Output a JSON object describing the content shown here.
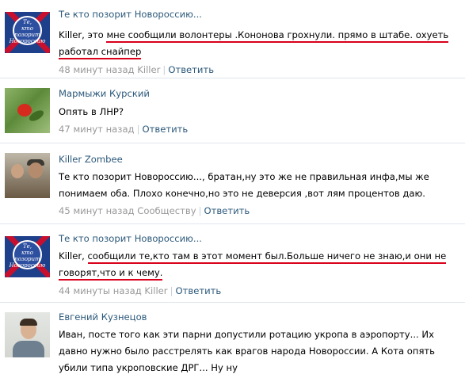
{
  "comments": [
    {
      "author": "Те кто позорит Новороссию...",
      "avatar_icon": "novorossiya-flag-avatar",
      "avatar_text": [
        "Те,",
        "кто",
        "позорит",
        "Новороссию"
      ],
      "text_prefix": "Killer, это ",
      "text_highlight": "мне сообщили волонтеры .Кононова грохнули. прямо в штабе. охуеть работал снайпер",
      "text_suffix": "",
      "time": "48 минут назад Killer",
      "reply": "Ответить"
    },
    {
      "author": "Мармыжи Курский",
      "avatar_icon": "flower-photo-avatar",
      "text_prefix": "Опять в ЛНР?",
      "text_highlight": "",
      "text_suffix": "",
      "time": "47 минут назад",
      "reply": "Ответить"
    },
    {
      "author": "Killer Zombee",
      "avatar_icon": "group-photo-avatar",
      "text_prefix": "Те кто позорит Новороссию..., братан,ну это же не правильная инфа,мы же понимаем оба. Плохо конечно,но это не деверсия ,вот лям процентов даю.",
      "text_highlight": "",
      "text_suffix": "",
      "time": "45 минут назад Сообществу",
      "reply": "Ответить"
    },
    {
      "author": "Те кто позорит Новороссию...",
      "avatar_icon": "novorossiya-flag-avatar",
      "avatar_text": [
        "Те,",
        "кто",
        "позорит",
        "Новороссию"
      ],
      "text_prefix": "Killer, ",
      "text_highlight": "сообщили те,кто там в этот момент был.Больше ничего не знаю,и они не говорят,что и к чему.",
      "text_suffix": "",
      "time": "44 минуты назад Killer",
      "reply": "Ответить"
    },
    {
      "author": "Евгений Кузнецов",
      "avatar_icon": "man-portrait-avatar",
      "text_prefix": "Иван, посте того как эти парни допустили ротацию укропа в аэропорту... Их давно нужно было расстрелять как врагов народа Новороссии. А Кота опять убили типа укроповские ДРГ... Ну ну",
      "text_highlight": "",
      "text_suffix": "",
      "time": "",
      "reply": ""
    }
  ],
  "colors": {
    "link": "#2b587a",
    "meta": "#999999",
    "separator": "#dfe5ec",
    "highlight_underline": "#d9001b"
  }
}
